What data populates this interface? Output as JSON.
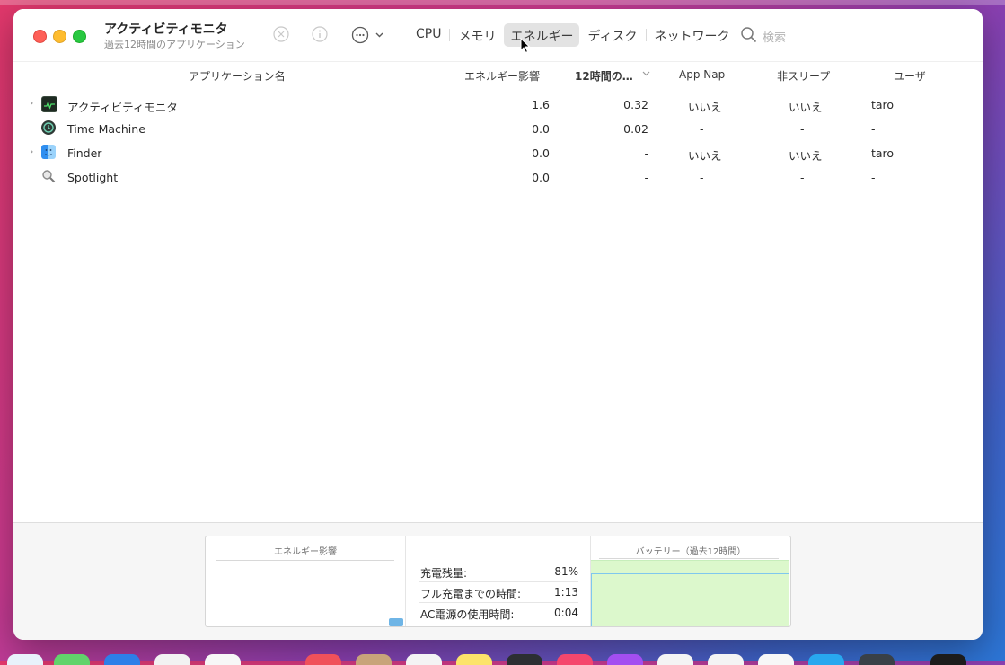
{
  "window": {
    "title": "アクティビティモニタ",
    "subtitle": "過去12時間のアプリケーション"
  },
  "toolbar": {
    "stop_icon": "x-circle-icon",
    "info_icon": "info-icon",
    "more_icon": "ellipsis-circle-icon",
    "tabs": [
      {
        "label": "CPU",
        "active": false
      },
      {
        "label": "メモリ",
        "active": false
      },
      {
        "label": "エネルギー",
        "active": true
      },
      {
        "label": "ディスク",
        "active": false
      },
      {
        "label": "ネットワーク",
        "active": false
      }
    ],
    "search_placeholder": "検索"
  },
  "table": {
    "headers": {
      "name": "アプリケーション名",
      "energy": "エネルギー影響",
      "twelve_hr": "12時間の…",
      "app_nap": "App Nap",
      "no_sleep": "非スリープ",
      "user": "ユーザ"
    },
    "rows": [
      {
        "expandable": true,
        "icon": "activity-monitor-icon",
        "name": "アクティビティモニタ",
        "energy": "1.6",
        "twelve_hr": "0.32",
        "app_nap": "いいえ",
        "no_sleep": "いいえ",
        "user": "taro"
      },
      {
        "expandable": false,
        "icon": "time-machine-icon",
        "name": "Time Machine",
        "energy": "0.0",
        "twelve_hr": "0.02",
        "app_nap": "-",
        "no_sleep": "-",
        "user": "-"
      },
      {
        "expandable": true,
        "icon": "finder-icon",
        "name": "Finder",
        "energy": "0.0",
        "twelve_hr": "-",
        "app_nap": "いいえ",
        "no_sleep": "いいえ",
        "user": "taro"
      },
      {
        "expandable": false,
        "icon": "spotlight-icon",
        "name": "Spotlight",
        "energy": "0.0",
        "twelve_hr": "-",
        "app_nap": "-",
        "no_sleep": "-",
        "user": "-"
      }
    ]
  },
  "bottom": {
    "energy_title": "エネルギー影響",
    "battery_title": "バッテリー（過去12時間）",
    "stats": [
      {
        "label": "充電残量:",
        "value": "81%"
      },
      {
        "label": "フル充電までの時間:",
        "value": "1:13"
      },
      {
        "label": "AC電源の使用時間:",
        "value": "0:04"
      }
    ]
  },
  "colors": {
    "battery_fill": "#dcf8cc",
    "battery_line": "#7fc7ee",
    "active_tab": "#e3e3e3"
  }
}
